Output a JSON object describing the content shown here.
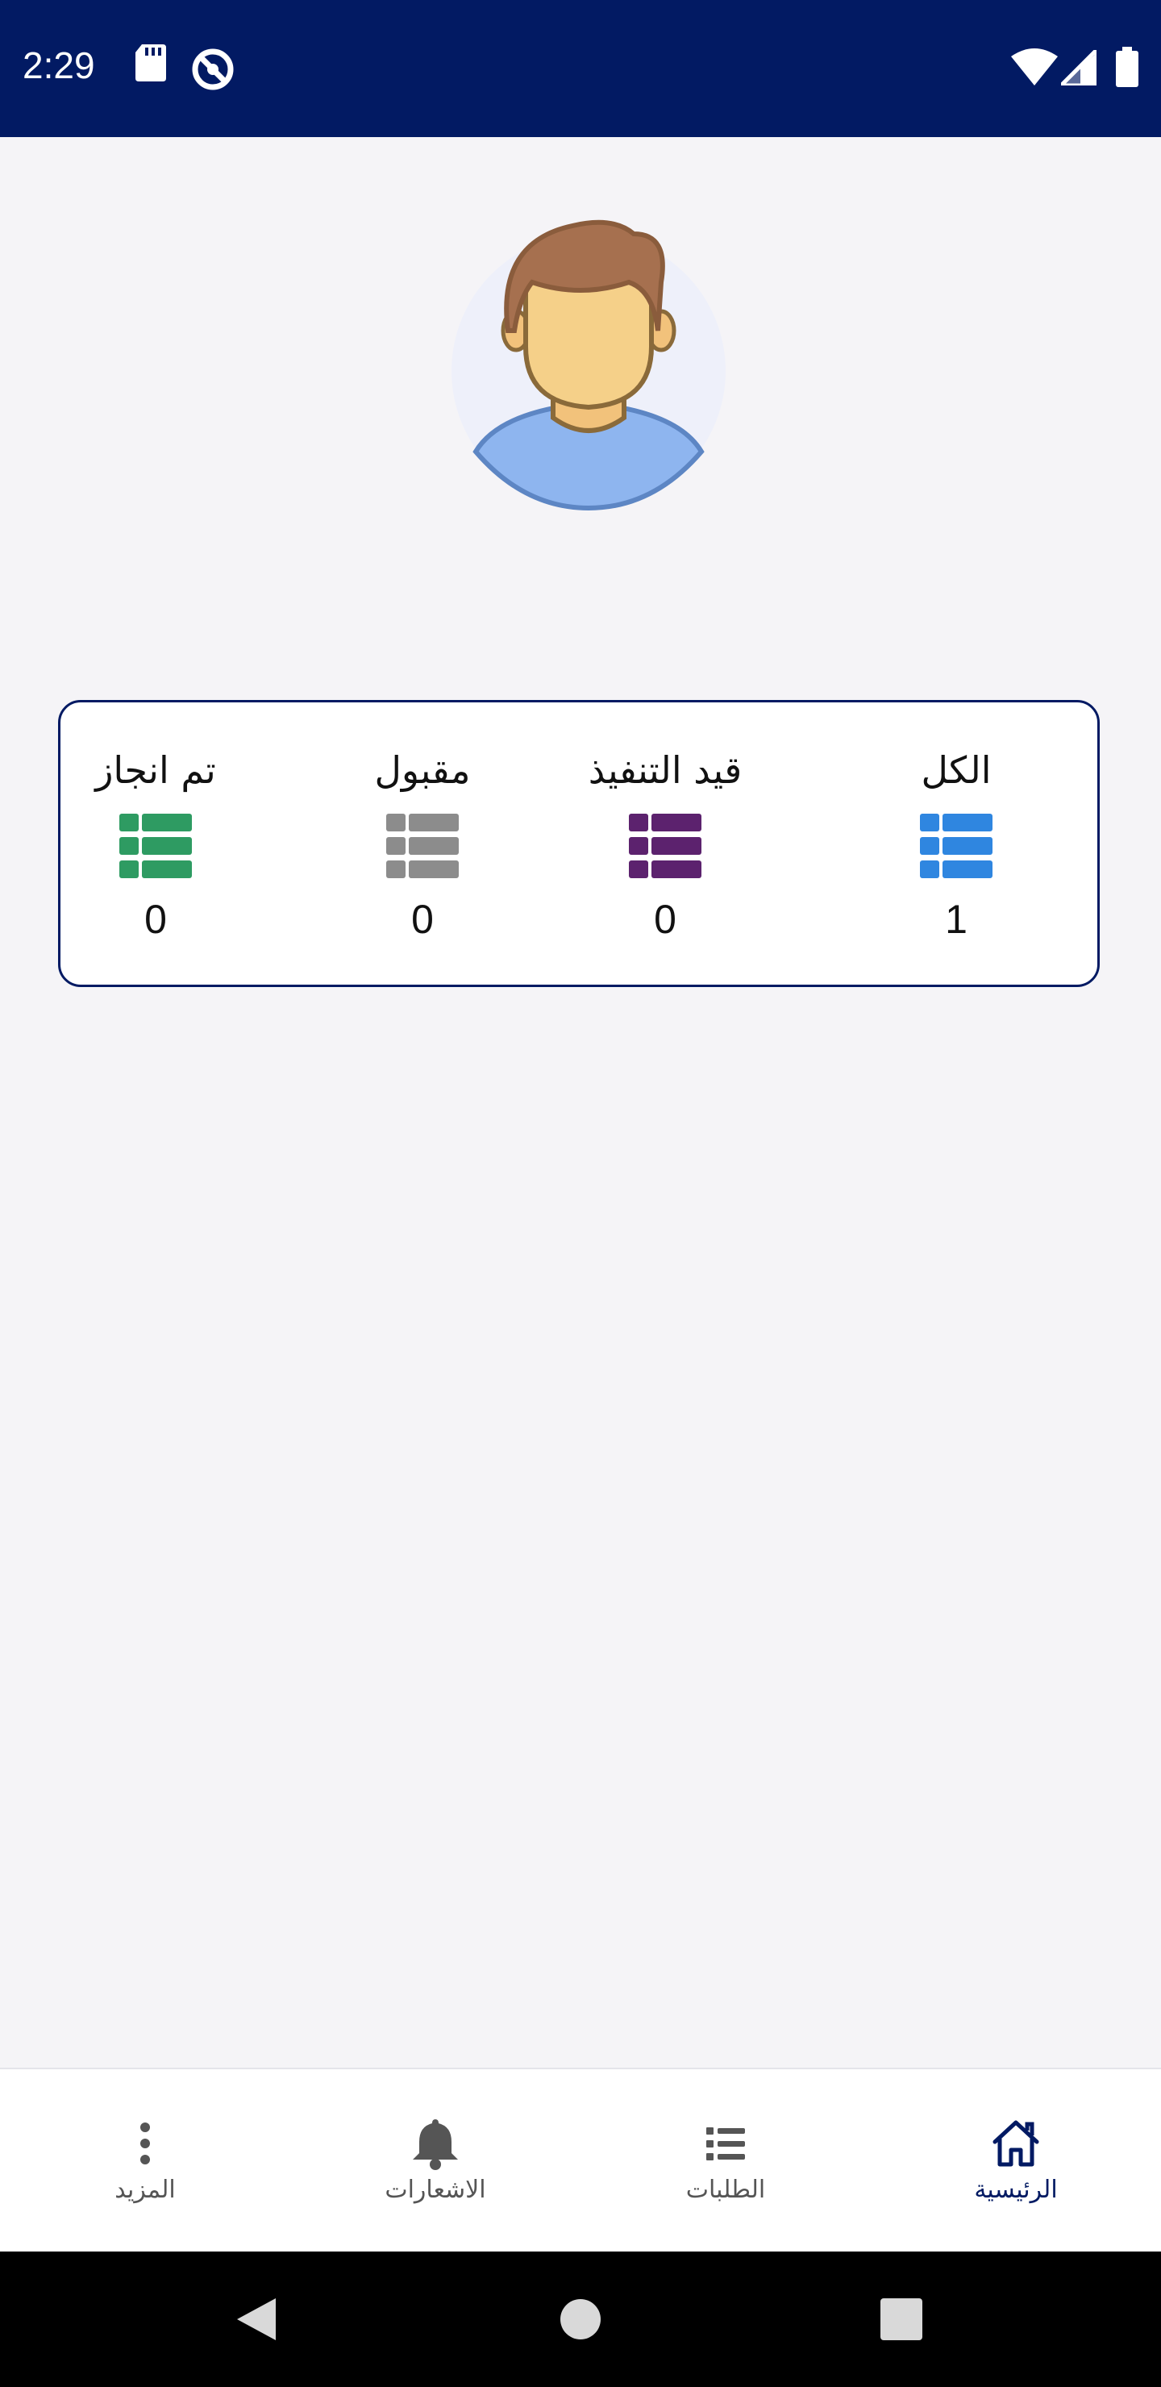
{
  "status_bar": {
    "time": "2:29",
    "background": "#021a63"
  },
  "profile": {
    "avatar_icon": "user-avatar-icon"
  },
  "stats": {
    "border_color": "#021a63",
    "items": [
      {
        "label": "الكل",
        "count": "1",
        "color": "#2f86e0",
        "icon": "table-list-icon"
      },
      {
        "label": "قيد التنفيذ",
        "count": "0",
        "color": "#5c226e",
        "icon": "table-list-icon"
      },
      {
        "label": "مقبول",
        "count": "0",
        "color": "#8c8c8c",
        "icon": "table-list-icon"
      },
      {
        "label": "تم انجاز",
        "count": "0",
        "color": "#2e9b62",
        "icon": "table-list-icon"
      }
    ]
  },
  "bottom_nav": {
    "items": [
      {
        "label": "الرئيسية",
        "icon": "home-icon",
        "active": true
      },
      {
        "label": "الطلبات",
        "icon": "list-icon",
        "active": false
      },
      {
        "label": "الاشعارات",
        "icon": "bell-icon",
        "active": false
      },
      {
        "label": "المزيد",
        "icon": "more-vertical-icon",
        "active": false
      }
    ],
    "active_color": "#021a63"
  },
  "system_nav": {
    "buttons": [
      "back-icon",
      "home-circle-icon",
      "recents-icon"
    ]
  }
}
